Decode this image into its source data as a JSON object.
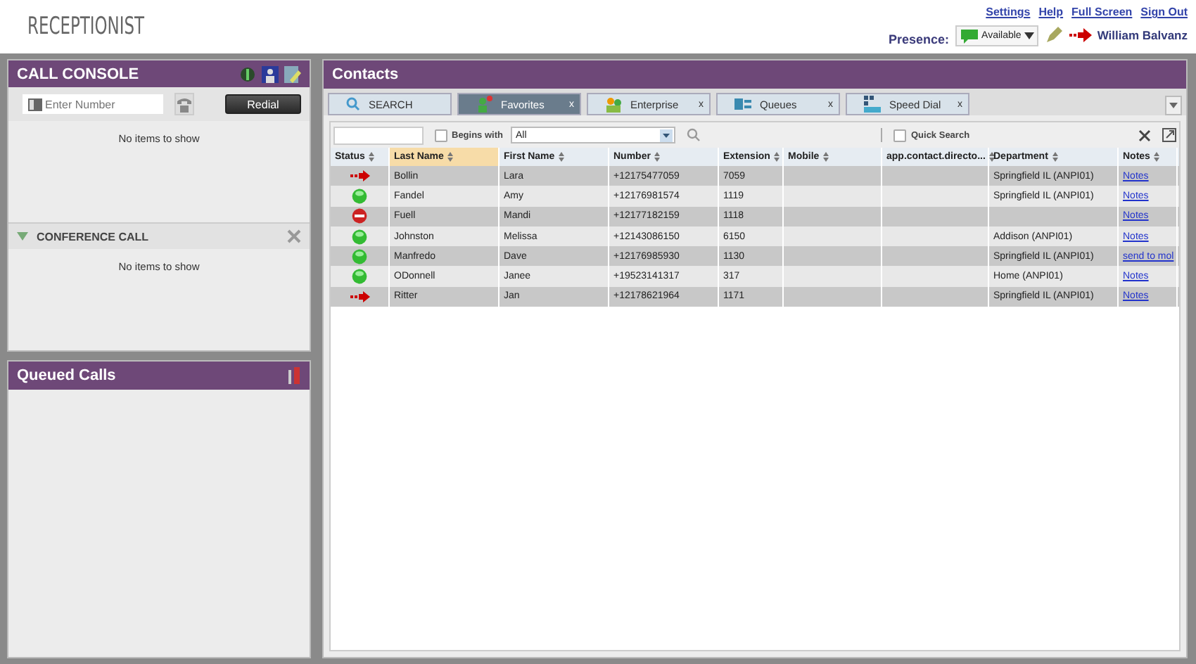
{
  "app_title": "RECEPTIONIST",
  "top_links": [
    "Settings",
    "Help",
    "Full Screen",
    "Sign Out"
  ],
  "presence": {
    "label": "Presence:",
    "value": "Available",
    "user": "William Balvanz"
  },
  "call_console": {
    "title": "CALL CONSOLE",
    "placeholder": "Enter Number",
    "redial": "Redial",
    "empty": "No items to show"
  },
  "conference_call": {
    "title": "CONFERENCE CALL",
    "expanded": true,
    "empty": "No items to show"
  },
  "queued_calls": {
    "title": "Queued Calls"
  },
  "contacts": {
    "title": "Contacts",
    "tabs": [
      {
        "label": "SEARCH",
        "selected": false
      },
      {
        "label": "Favorites",
        "close": "x",
        "selected": true
      },
      {
        "label": "Enterprise",
        "close": "x",
        "selected": false
      },
      {
        "label": "Queues",
        "close": "x",
        "selected": false
      },
      {
        "label": "Speed Dial",
        "close": "x",
        "selected": false
      }
    ],
    "begins_with": {
      "label": "Begins with",
      "checked": false
    },
    "filter": "All",
    "quick_search": {
      "label": "Quick Search",
      "checked": false
    },
    "status_column": "Status",
    "columns": [
      {
        "label": "Last Name",
        "sorted": true
      },
      {
        "label": "First Name",
        "sorted": false
      },
      {
        "label": "Number",
        "sorted": false
      },
      {
        "label": "Extension",
        "sorted": false
      },
      {
        "label": "Mobile",
        "sorted": false
      },
      {
        "label": "app.contact.directo...",
        "sorted": false
      },
      {
        "label": "Department",
        "sorted": false
      },
      {
        "label": "Notes",
        "sorted": false
      }
    ],
    "rows": [
      {
        "kind": "busy",
        "cells": [
          "Bollin",
          "Lara",
          "+12175477059",
          "7059",
          "",
          "",
          "Springfield IL (ANPI01)",
          "Notes"
        ]
      },
      {
        "kind": "available",
        "cells": [
          "Fandel",
          "Amy",
          "+12176981574",
          "1119",
          "",
          "",
          "Springfield IL (ANPI01)",
          "Notes"
        ]
      },
      {
        "kind": "dnd",
        "cells": [
          "Fuell",
          "Mandi",
          "+12177182159",
          "1118",
          "",
          "",
          "",
          "Notes"
        ]
      },
      {
        "kind": "available",
        "cells": [
          "Johnston",
          "Melissa",
          "+12143086150",
          "6150",
          "",
          "",
          "Addison (ANPI01)",
          "Notes"
        ]
      },
      {
        "kind": "available",
        "cells": [
          "Manfredo",
          "Dave",
          "+12176985930",
          "1130",
          "",
          "",
          "Springfield IL (ANPI01)",
          "send to mol"
        ]
      },
      {
        "kind": "available",
        "cells": [
          "ODonnell",
          "Janee",
          "+19523141317",
          "317",
          "",
          "",
          "Home (ANPI01)",
          "Notes"
        ]
      },
      {
        "kind": "busy",
        "cells": [
          "Ritter",
          "Jan",
          "+12178621964",
          "1171",
          "",
          "",
          "Springfield IL (ANPI01)",
          "Notes"
        ]
      }
    ]
  }
}
